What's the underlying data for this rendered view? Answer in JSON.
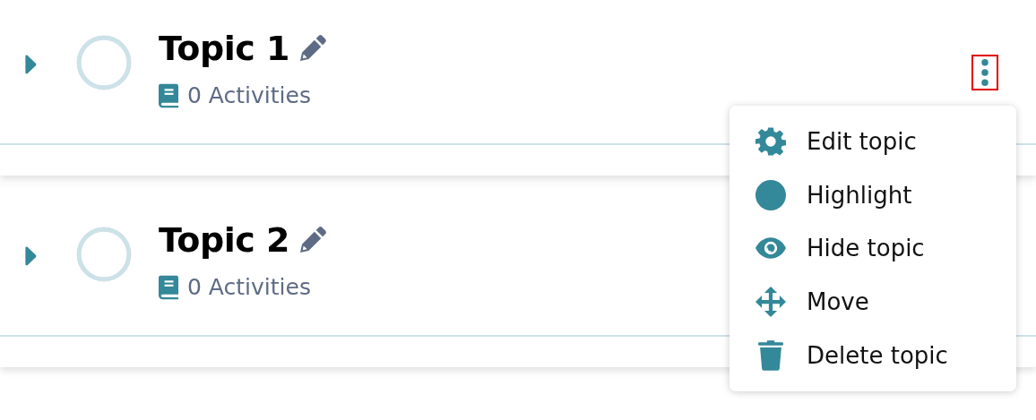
{
  "topics": [
    {
      "title": "Topic 1",
      "activities": "0 Activities",
      "expanded": false,
      "menu_button": {
        "outlined": true
      }
    },
    {
      "title": "Topic 2",
      "activities": "0 Activities",
      "expanded": false
    }
  ],
  "menu": {
    "items": [
      {
        "label": "Edit topic",
        "kind": "gear"
      },
      {
        "label": "Highlight",
        "kind": "circle"
      },
      {
        "label": "Hide topic",
        "kind": "eye"
      },
      {
        "label": "Move",
        "kind": "move"
      },
      {
        "label": "Delete topic",
        "kind": "trash"
      }
    ]
  }
}
